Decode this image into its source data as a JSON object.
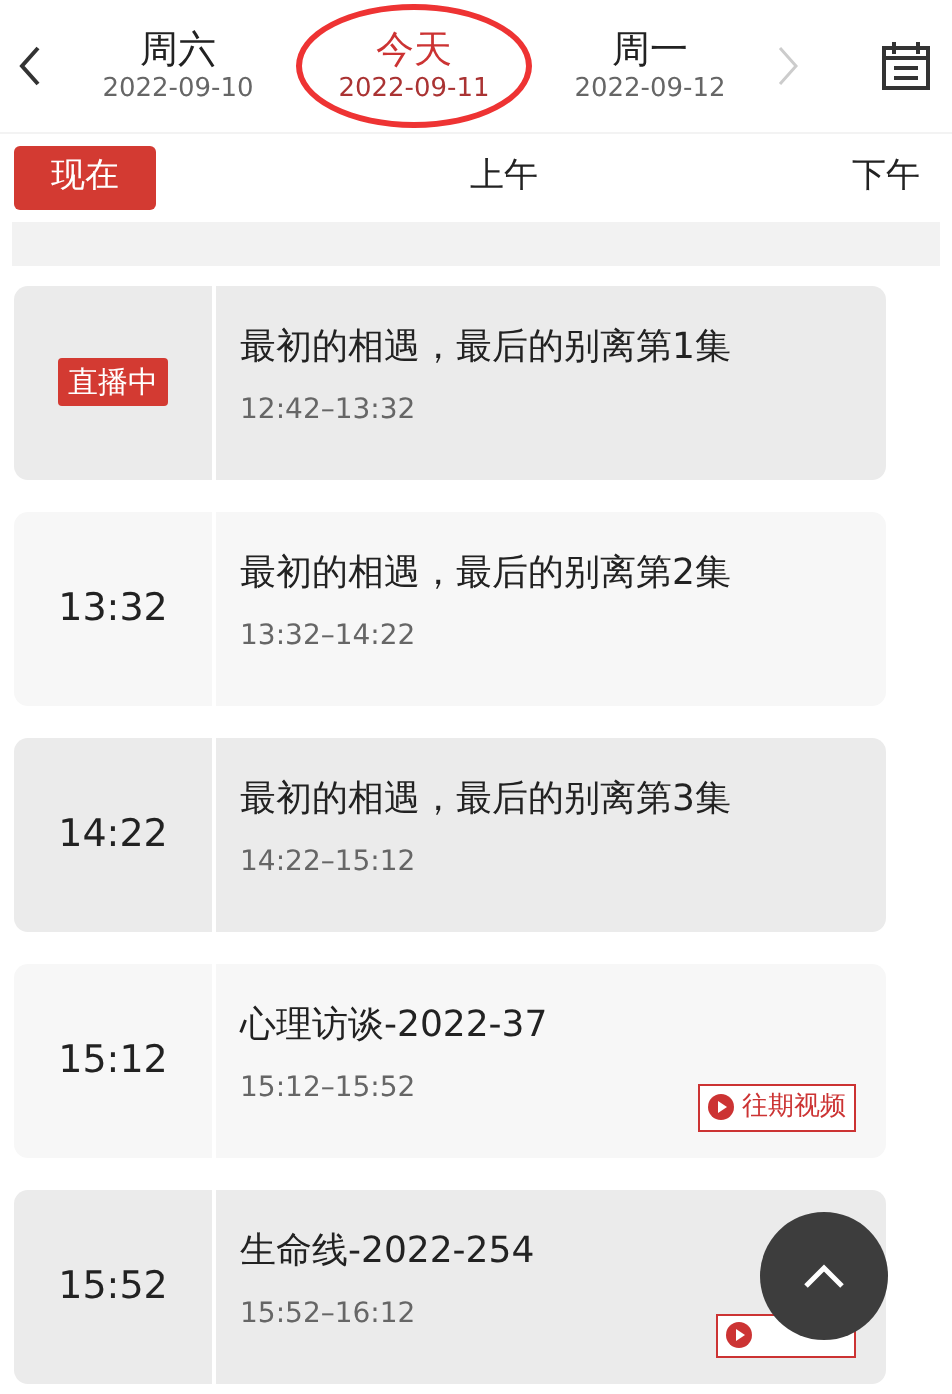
{
  "date_tabs": [
    {
      "day": "周六",
      "date": "2022-09-10",
      "selected": false
    },
    {
      "day": "今天",
      "date": "2022-09-11",
      "selected": true
    },
    {
      "day": "周一",
      "date": "2022-09-12",
      "selected": false
    }
  ],
  "period_tabs": [
    {
      "label": "现在",
      "selected": true
    },
    {
      "label": "上午",
      "selected": false
    },
    {
      "label": "下午",
      "selected": false
    }
  ],
  "programs": [
    {
      "kind": "live",
      "start": "直播中",
      "title": "最初的相遇，最后的别离第1集",
      "time": "12:42–13:32"
    },
    {
      "kind": "plain",
      "start": "13:32",
      "title": "最初的相遇，最后的别离第2集",
      "time": "13:32–14:22"
    },
    {
      "kind": "plain",
      "start": "14:22",
      "title": "最初的相遇，最后的别离第3集",
      "time": "14:22–15:12"
    },
    {
      "kind": "replay",
      "start": "15:12",
      "title": "心理访谈-2022-37",
      "time": "15:12–15:52",
      "replay_label": "往期视频"
    },
    {
      "kind": "replay_covered",
      "start": "15:52",
      "title": "生命线-2022-254",
      "time": "15:52–16:12"
    }
  ]
}
